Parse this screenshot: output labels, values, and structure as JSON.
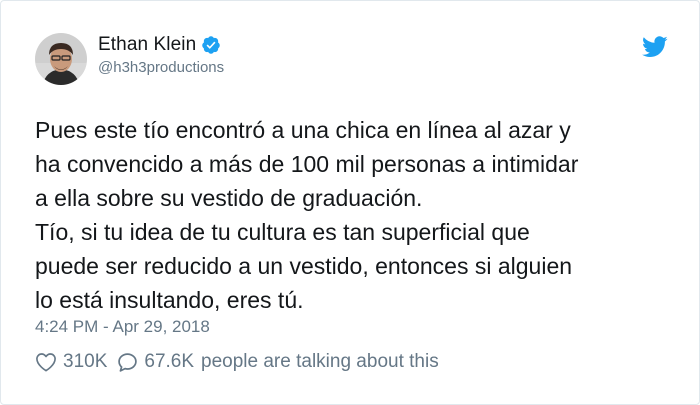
{
  "author": {
    "name": "Ethan Klein",
    "handle": "@h3h3productions",
    "verified": true,
    "avatar_icon": "profile-photo"
  },
  "tweet": {
    "lines": [
      "Pues este tío encontró a una chica en línea al azar y",
      "ha convencido a más de 100 mil personas a intimidar",
      "a ella sobre su vestido de graduación.",
      "Tío, si tu idea de tu cultura es tan superficial que",
      "puede ser reducido a un vestido, entonces si alguien",
      "lo está insultando, eres tú."
    ],
    "timestamp": "4:24 PM - Apr 29, 2018"
  },
  "engagement": {
    "likes": "310K",
    "replies": "67.6K",
    "talking_label": "people are talking about this"
  },
  "icons": {
    "like": "heart-icon",
    "reply": "speech-bubble-icon",
    "brand": "twitter-bird-icon",
    "verified": "verified-badge-icon"
  },
  "colors": {
    "twitter_blue": "#1da1f2",
    "secondary_text": "#657786",
    "primary_text": "#14171a"
  }
}
